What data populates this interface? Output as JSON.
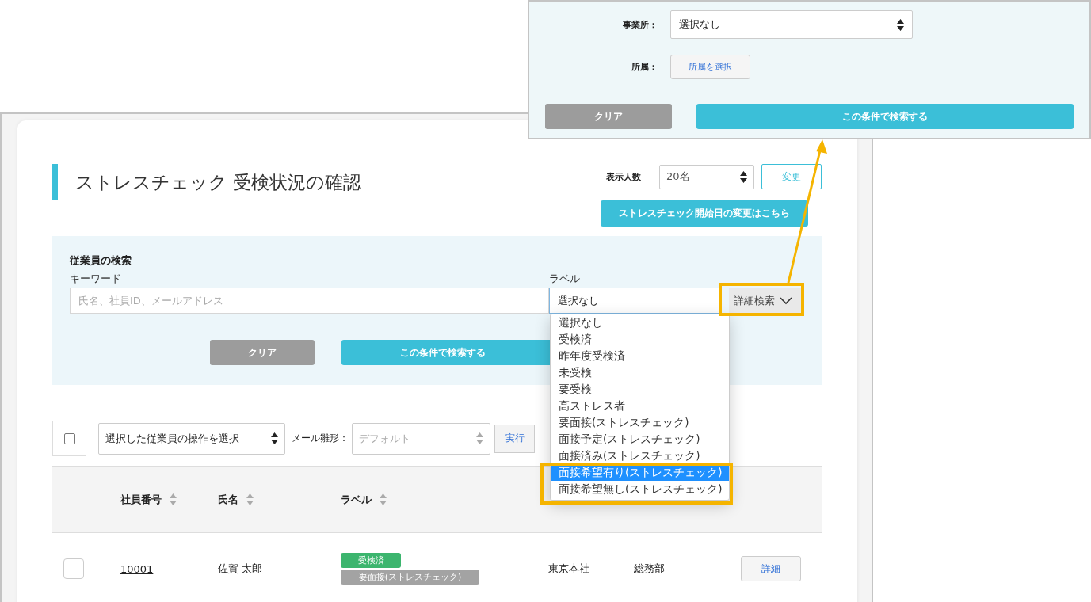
{
  "page": {
    "title": "ストレスチェック 受検状況の確認",
    "display_count": {
      "label": "表示人数",
      "value": "20名"
    },
    "change_button": "変更",
    "start_date_button": "ストレスチェック開始日の変更はこちら"
  },
  "search": {
    "heading": "従業員の検索",
    "keyword": {
      "label": "キーワード",
      "placeholder": "氏名、社員ID、メールアドレス"
    },
    "label_select": {
      "label": "ラベル",
      "value": "選択なし"
    },
    "detail_button": "詳細検索",
    "clear_button": "クリア",
    "search_button": "この条件で検索する"
  },
  "label_dropdown": {
    "options": [
      {
        "label": "選択なし",
        "selected": false
      },
      {
        "label": "受検済",
        "selected": false
      },
      {
        "label": "昨年度受検済",
        "selected": false
      },
      {
        "label": "未受検",
        "selected": false
      },
      {
        "label": "要受検",
        "selected": false
      },
      {
        "label": "高ストレス者",
        "selected": false
      },
      {
        "label": "要面接(ストレスチェック)",
        "selected": false
      },
      {
        "label": "面接予定(ストレスチェック)",
        "selected": false
      },
      {
        "label": "面接済み(ストレスチェック)",
        "selected": false
      },
      {
        "label": "面接希望有り(ストレスチェック)",
        "selected": true
      },
      {
        "label": "面接希望無し(ストレスチェック)",
        "selected": false
      }
    ]
  },
  "toolbar": {
    "select_all_checked": false,
    "action_select": "選択した従業員の操作を選択",
    "mail_label": "メール雛形：",
    "mail_select": {
      "placeholder": "デフォルト"
    },
    "run_button": "実行"
  },
  "table": {
    "columns": [
      "社員番号",
      "氏名",
      "ラベル"
    ],
    "rows": [
      {
        "checked": false,
        "employee_id": "10001",
        "name": "佐賀 太郎",
        "labels": [
          {
            "text": "受検済",
            "color": "#3cb56e"
          },
          {
            "text": "要面接(ストレスチェック)",
            "color": "#a3a3a3"
          }
        ],
        "column_4": "東京本社",
        "column_5": "総務部",
        "action": "詳細"
      }
    ]
  },
  "detail_panel": {
    "office_label": "事業所：",
    "office_value": "選択なし",
    "dept_label": "所属：",
    "dept_button": "所属を選択",
    "clear_button": "クリア",
    "search_button": "この条件で検索する"
  }
}
